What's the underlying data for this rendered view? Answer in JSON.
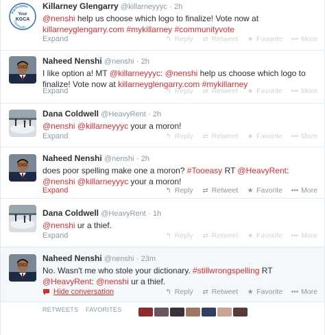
{
  "tweets": [
    {
      "name": "Killarney Glengarry",
      "handle": "@killarneyyyc",
      "sep": "·",
      "time": "2h",
      "avatar_lines": [
        "Participate",
        "Your",
        "KGCA",
        "Community"
      ],
      "avatar_type": "logo",
      "text_parts": [
        {
          "t": "@nenshi",
          "k": "mention"
        },
        {
          "t": " help us choose which logo to finalize! Vote now at ",
          "k": "plain"
        },
        {
          "t": "killarneyglengarry.com",
          "k": "link"
        },
        {
          "t": " ",
          "k": "plain"
        },
        {
          "t": "#mykillarney",
          "k": "hashtag"
        },
        {
          "t": " ",
          "k": "plain"
        },
        {
          "t": "#communityvote",
          "k": "hashtag"
        }
      ],
      "expand": "Expand",
      "actions": {
        "reply": "Reply",
        "retweet": "Retweet",
        "favorite": "Favorite",
        "more": "More"
      }
    },
    {
      "name": "Naheed Nenshi",
      "handle": "@nenshi",
      "sep": "·",
      "time": "2h",
      "avatar_type": "person",
      "text_parts": [
        {
          "t": "I like option a! MT ",
          "k": "plain"
        },
        {
          "t": "@killarneyyyc",
          "k": "mention"
        },
        {
          "t": ": ",
          "k": "plain"
        },
        {
          "t": "@nenshi",
          "k": "mention"
        },
        {
          "t": " help us choose which logo to finalize! Vote now at ",
          "k": "plain"
        },
        {
          "t": "killarneyglengarry.com",
          "k": "link"
        },
        {
          "t": " ",
          "k": "plain"
        },
        {
          "t": "#mykillarney",
          "k": "hashtag"
        }
      ],
      "expand": "Expand",
      "actions": {
        "reply": "Reply",
        "retweet": "Retweet",
        "favorite": "Favorite",
        "more": "More"
      }
    },
    {
      "name": "Dana Coldwell",
      "handle": "@HeavyRent",
      "sep": "·",
      "time": "2h",
      "avatar_type": "rink",
      "text_parts": [
        {
          "t": "@nenshi",
          "k": "mention"
        },
        {
          "t": " ",
          "k": "plain"
        },
        {
          "t": "@killarneyyyc",
          "k": "mention"
        },
        {
          "t": " your a moron!",
          "k": "plain"
        }
      ],
      "expand": "Expand",
      "actions": {
        "reply": "Reply",
        "retweet": "Retweet",
        "favorite": "Favorite",
        "more": "More"
      }
    },
    {
      "name": "Naheed Nenshi",
      "handle": "@nenshi",
      "sep": "·",
      "time": "2h",
      "avatar_type": "person",
      "text_parts": [
        {
          "t": "does poor spelling make one a moron? ",
          "k": "plain"
        },
        {
          "t": "#Tooeasy",
          "k": "hashtag"
        },
        {
          "t": " RT ",
          "k": "plain"
        },
        {
          "t": "@HeavyRent",
          "k": "mention"
        },
        {
          "t": ": ",
          "k": "plain"
        },
        {
          "t": "@nenshi",
          "k": "mention"
        },
        {
          "t": " ",
          "k": "plain"
        },
        {
          "t": "@killarneyyyc",
          "k": "mention"
        },
        {
          "t": " your a moron!",
          "k": "plain"
        }
      ],
      "expand": "Expand",
      "actions": {
        "reply": "Reply",
        "retweet": "Retweet",
        "favorite": "Favorite",
        "more": "More"
      }
    },
    {
      "name": "Dana Coldwell",
      "handle": "@HeavyRent",
      "sep": "·",
      "time": "1h",
      "avatar_type": "rink",
      "text_parts": [
        {
          "t": "@nenshi",
          "k": "mention"
        },
        {
          "t": " ur a thief.",
          "k": "plain"
        }
      ],
      "expand": "Expand",
      "actions": {
        "reply": "Reply",
        "retweet": "Retweet",
        "favorite": "Favorite",
        "more": "More"
      }
    },
    {
      "name": "Naheed Nenshi",
      "handle": "@nenshi",
      "sep": "·",
      "time": "23m",
      "avatar_type": "person",
      "text_parts": [
        {
          "t": "No. Wasn't me who stole your dictionary. ",
          "k": "plain"
        },
        {
          "t": "#stillwrongspelling",
          "k": "hashtag"
        },
        {
          "t": " RT ",
          "k": "plain"
        },
        {
          "t": "@HeavyRent",
          "k": "mention"
        },
        {
          "t": ": ",
          "k": "plain"
        },
        {
          "t": "@nenshi",
          "k": "mention"
        },
        {
          "t": " ur a thief.",
          "k": "plain"
        }
      ],
      "hide_conversation": "Hide conversation",
      "actions": {
        "reply": "Reply",
        "retweet": "Retweet",
        "favorite": "Favorite",
        "more": "More"
      }
    }
  ],
  "footer": {
    "retweets_label": "RETWEETS",
    "favorites_label": "FAVORITES"
  },
  "colors": {
    "accent": "#d32f2f",
    "muted": "#8899a6",
    "faint": "#ccd6dd"
  },
  "icons": {
    "reply": "reply-icon",
    "retweet": "retweet-icon",
    "favorite": "star-icon",
    "more": "more-icon",
    "hide": "speech-bubble-icon"
  }
}
